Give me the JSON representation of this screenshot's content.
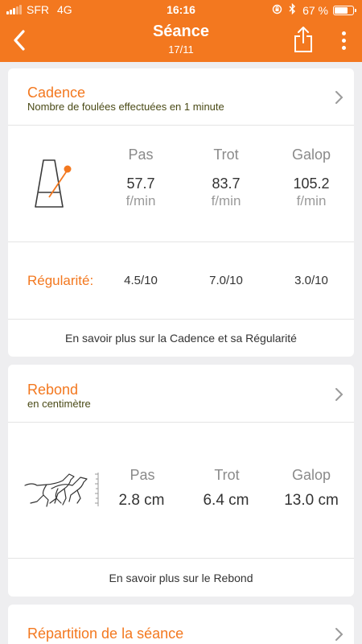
{
  "status_bar": {
    "carrier": "SFR",
    "network": "4G",
    "time": "16:16",
    "battery_percent": "67 %",
    "battery_level": 0.67,
    "icons": [
      "signal-icon",
      "lock-rotation-icon",
      "bluetooth-icon",
      "battery-icon"
    ]
  },
  "nav": {
    "title": "Séance",
    "subtitle": "17/11",
    "icons": [
      "back-chevron-icon",
      "share-icon",
      "more-vertical-icon"
    ]
  },
  "colors": {
    "accent": "#f3781f",
    "subtitle_text": "#4a4a16",
    "background": "#eeeef0",
    "card": "#ffffff"
  },
  "cadence": {
    "title": "Cadence",
    "subtitle": "Nombre de foulées effectuées en 1 minute",
    "icon": "metronome-icon",
    "gaits": [
      {
        "label": "Pas",
        "value": "57.7",
        "unit": "f/min"
      },
      {
        "label": "Trot",
        "value": "83.7",
        "unit": "f/min"
      },
      {
        "label": "Galop",
        "value": "105.2",
        "unit": "f/min"
      }
    ],
    "regularity_label": "Régularité:",
    "regularity": [
      "4.5/10",
      "7.0/10",
      "3.0/10"
    ],
    "link": "En savoir plus sur la Cadence et sa Régularité"
  },
  "rebond": {
    "title": "Rebond",
    "subtitle": "en centimètre",
    "icon": "jumping-horse-icon",
    "gaits": [
      {
        "label": "Pas",
        "value": "2.8 cm"
      },
      {
        "label": "Trot",
        "value": "6.4 cm"
      },
      {
        "label": "Galop",
        "value": "13.0 cm"
      }
    ],
    "link": "En savoir plus sur le Rebond"
  },
  "repartition": {
    "title": "Répartition de la séance"
  }
}
